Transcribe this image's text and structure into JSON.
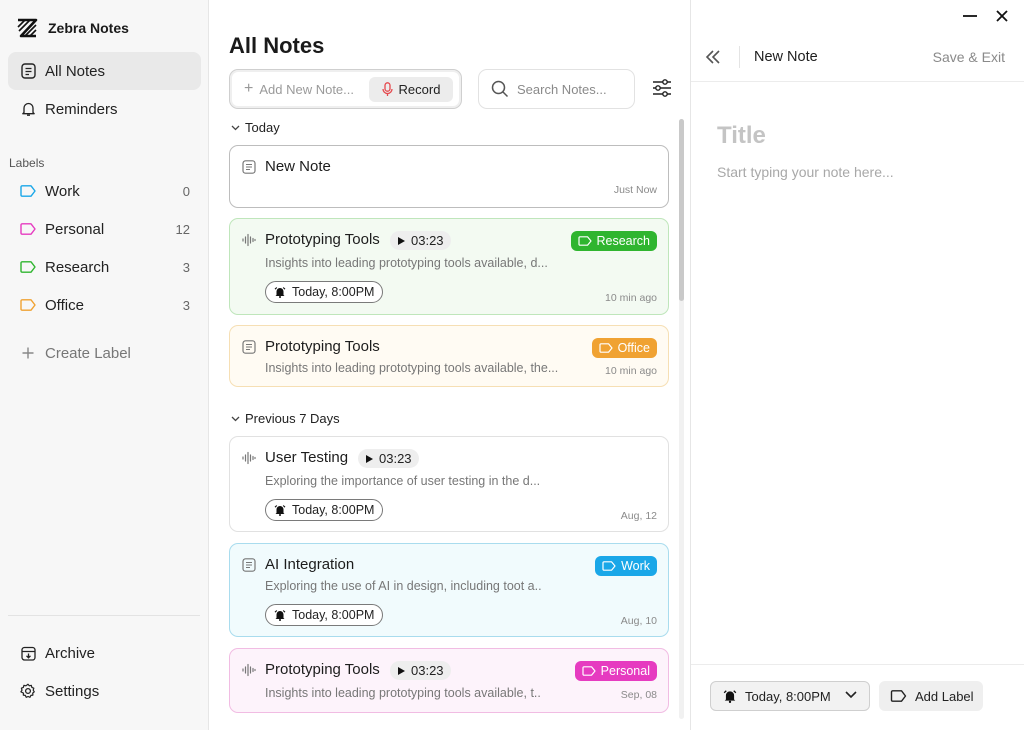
{
  "app": {
    "name": "Zebra Notes"
  },
  "sidebar": {
    "nav": [
      {
        "label": "All Notes",
        "icon": "notes-icon",
        "active": true
      },
      {
        "label": "Reminders",
        "icon": "bell-icon",
        "active": false
      }
    ],
    "labels_title": "Labels",
    "labels": [
      {
        "label": "Work",
        "count": "0",
        "color": "#1aa7e8"
      },
      {
        "label": "Personal",
        "count": "12",
        "color": "#e63bc0"
      },
      {
        "label": "Research",
        "count": "3",
        "color": "#2fb52f"
      },
      {
        "label": "Office",
        "count": "3",
        "color": "#f0a232"
      }
    ],
    "create_label": "Create Label",
    "bottom": [
      {
        "label": "Archive",
        "icon": "archive-icon"
      },
      {
        "label": "Settings",
        "icon": "gear-icon"
      }
    ]
  },
  "notes": {
    "title": "All Notes",
    "add_placeholder": "Add New Note...",
    "record_label": "Record",
    "search_placeholder": "Search Notes...",
    "groups": [
      {
        "label": "Today"
      },
      {
        "label": "Previous 7 Days"
      }
    ],
    "items": [
      {
        "title": "New Note",
        "time": "Just Now",
        "type": "text"
      },
      {
        "title": "Prototyping Tools",
        "duration": "03:23",
        "desc": "Insights into leading prototyping tools available, d...",
        "reminder": "Today, 8:00PM",
        "time": "10 min ago",
        "badge": "Research",
        "badge_color": "#2fb52f",
        "bg": "#f3faf2",
        "border": "#bfe6bb",
        "type": "audio"
      },
      {
        "title": "Prototyping Tools",
        "desc": "Insights into leading prototyping tools available, the...",
        "time": "10 min ago",
        "badge": "Office",
        "badge_color": "#f0a232",
        "bg": "#fffbf3",
        "border": "#f6dfb4",
        "type": "text"
      },
      {
        "title": "User Testing",
        "duration": "03:23",
        "desc": "Exploring the importance of user testing in the d...",
        "reminder": "Today, 8:00PM",
        "time": "Aug, 12",
        "type": "audio"
      },
      {
        "title": "AI Integration",
        "desc": "Exploring the use of AI in design, including toot a..",
        "reminder": "Today, 8:00PM",
        "time": "Aug, 10",
        "badge": "Work",
        "badge_color": "#1aa7e8",
        "bg": "#f1fbfd",
        "border": "#a9dcee",
        "type": "text"
      },
      {
        "title": "Prototyping Tools",
        "duration": "03:23",
        "desc": "Insights into leading prototyping tools available, t..",
        "time": "Sep, 08",
        "badge": "Personal",
        "badge_color": "#e63bc0",
        "bg": "#fdf3fb",
        "border": "#f1bce3",
        "type": "audio"
      }
    ]
  },
  "editor": {
    "title": "New Note",
    "save_exit": "Save & Exit",
    "title_placeholder": "Title",
    "body_placeholder": "Start typing your note here...",
    "reminder": "Today, 8:00PM",
    "add_label": "Add Label"
  }
}
